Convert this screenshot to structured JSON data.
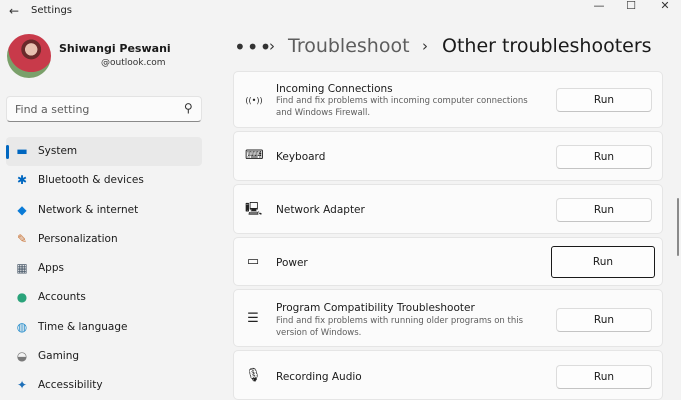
{
  "window": {
    "app_title": "Settings",
    "back_glyph": "←",
    "minimize_glyph": "—",
    "maximize_glyph": "☐",
    "close_glyph": "✕"
  },
  "user": {
    "name": "Shiwangi Peswani",
    "email": "@outlook.com"
  },
  "search": {
    "placeholder": "Find a setting",
    "icon": "search-icon",
    "icon_glyph": "⚲"
  },
  "sidebar": {
    "items": [
      {
        "label": "System",
        "icon": "display-icon",
        "glyph": "▬",
        "color": "#0067c0",
        "selected": true
      },
      {
        "label": "Bluetooth & devices",
        "icon": "bluetooth-icon",
        "glyph": "✱",
        "color": "#0067c0"
      },
      {
        "label": "Network & internet",
        "icon": "wifi-icon",
        "glyph": "◆",
        "color": "#0a7bd7"
      },
      {
        "label": "Personalization",
        "icon": "brush-icon",
        "glyph": "✎",
        "color": "#c66b2a"
      },
      {
        "label": "Apps",
        "icon": "apps-icon",
        "glyph": "▦",
        "color": "#4a5a6a"
      },
      {
        "label": "Accounts",
        "icon": "person-icon",
        "glyph": "●",
        "color": "#2aa37a"
      },
      {
        "label": "Time & language",
        "icon": "globe-icon",
        "glyph": "◍",
        "color": "#1d88c9"
      },
      {
        "label": "Gaming",
        "icon": "controller-icon",
        "glyph": "◒",
        "color": "#7a7a7a"
      },
      {
        "label": "Accessibility",
        "icon": "accessibility-icon",
        "glyph": "✦",
        "color": "#1d6fb8"
      }
    ]
  },
  "breadcrumb": {
    "dots": "•••",
    "separator": "›",
    "parent": "Troubleshoot",
    "current": "Other troubleshooters"
  },
  "troubleshooters": [
    {
      "title": "Incoming Connections",
      "description": "Find and fix problems with incoming computer connections and Windows Firewall.",
      "icon": "antenna-icon",
      "glyph": "((•))",
      "button": "Run"
    },
    {
      "title": "Keyboard",
      "description": "",
      "icon": "keyboard-icon",
      "glyph": "⌨",
      "button": "Run"
    },
    {
      "title": "Network Adapter",
      "description": "",
      "icon": "network-adapter-icon",
      "glyph": "🖳",
      "button": "Run"
    },
    {
      "title": "Power",
      "description": "",
      "icon": "battery-icon",
      "glyph": "▭",
      "button": "Run",
      "focused": true
    },
    {
      "title": "Program Compatibility Troubleshooter",
      "description": "Find and fix problems with running older programs on this version of Windows.",
      "icon": "list-icon",
      "glyph": "☰",
      "button": "Run"
    },
    {
      "title": "Recording Audio",
      "description": "",
      "icon": "microphone-icon",
      "glyph": "🎙",
      "button": "Run"
    }
  ]
}
